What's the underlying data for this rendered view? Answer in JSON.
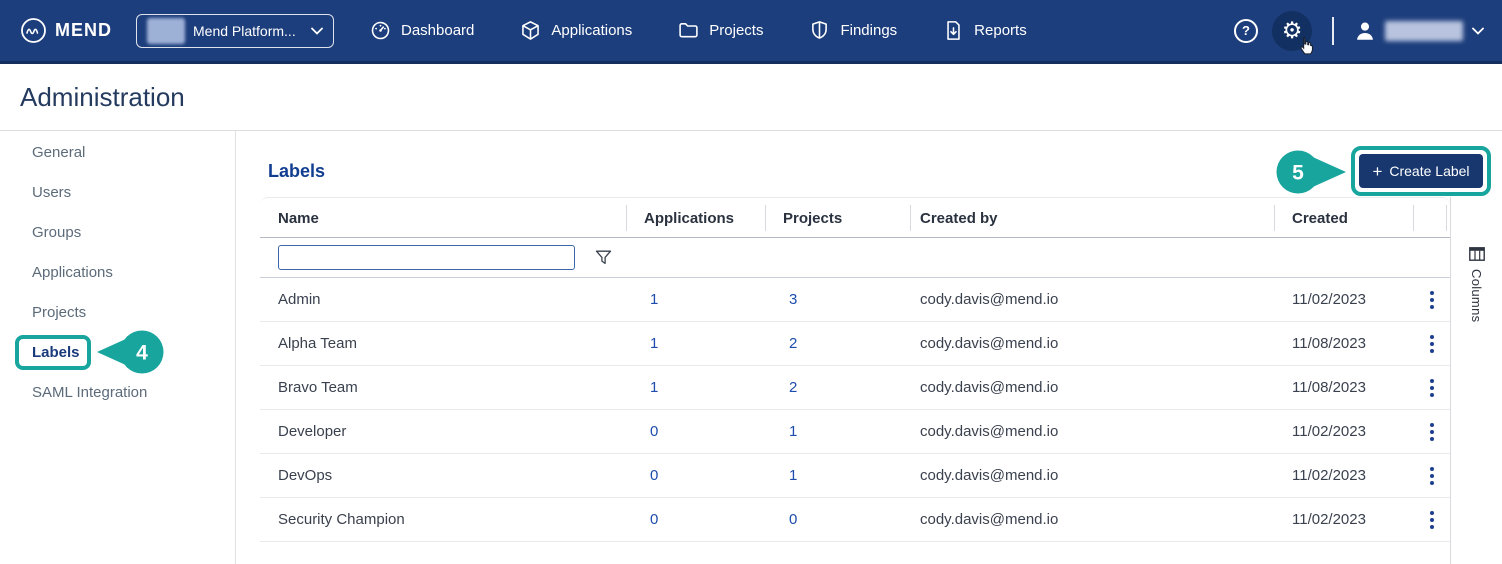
{
  "navbar": {
    "brand": "MEND",
    "org_dropdown": {
      "label": "Mend Platform..."
    },
    "items": [
      {
        "label": "Dashboard",
        "icon": "gauge-icon"
      },
      {
        "label": "Applications",
        "icon": "cube-icon"
      },
      {
        "label": "Projects",
        "icon": "folder-icon"
      },
      {
        "label": "Findings",
        "icon": "shield-icon"
      },
      {
        "label": "Reports",
        "icon": "report-download-icon"
      }
    ],
    "help_glyph": "?",
    "gear_glyph": "⚙"
  },
  "header": {
    "title": "Administration"
  },
  "sidebar": {
    "items": [
      "General",
      "Users",
      "Groups",
      "Applications",
      "Projects",
      "Labels",
      "SAML Integration"
    ],
    "active_item": "Labels"
  },
  "content": {
    "section_title": "Labels",
    "create_button": {
      "plus_icon": "+",
      "label": "Create Label"
    },
    "columns_panel_label": "Columns",
    "table": {
      "headers": [
        "Name",
        "Applications",
        "Projects",
        "Created by",
        "Created"
      ],
      "filter_value": "",
      "rows": [
        {
          "name": "Admin",
          "applications": "1",
          "projects": "3",
          "created_by": "cody.davis@mend.io",
          "created": "11/02/2023"
        },
        {
          "name": "Alpha Team",
          "applications": "1",
          "projects": "2",
          "created_by": "cody.davis@mend.io",
          "created": "11/08/2023"
        },
        {
          "name": "Bravo Team",
          "applications": "1",
          "projects": "2",
          "created_by": "cody.davis@mend.io",
          "created": "11/08/2023"
        },
        {
          "name": "Developer",
          "applications": "0",
          "projects": "1",
          "created_by": "cody.davis@mend.io",
          "created": "11/02/2023"
        },
        {
          "name": "DevOps",
          "applications": "0",
          "projects": "1",
          "created_by": "cody.davis@mend.io",
          "created": "11/02/2023"
        },
        {
          "name": "Security Champion",
          "applications": "0",
          "projects": "0",
          "created_by": "cody.davis@mend.io",
          "created": "11/02/2023"
        }
      ]
    }
  },
  "callouts": {
    "step4": "4",
    "step5": "5",
    "accent_color": "#17a59e"
  },
  "colors": {
    "navbar": "#1d3e7c",
    "button_navy": "#17376e",
    "link_blue": "#1d4cad",
    "accent_teal": "#17a59e"
  }
}
